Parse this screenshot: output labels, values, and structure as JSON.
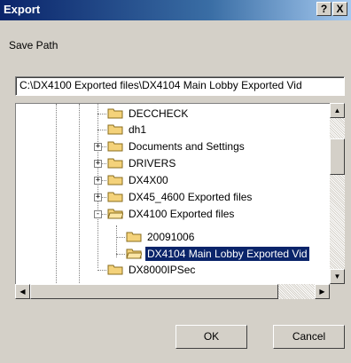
{
  "window": {
    "title": "Export",
    "help_glyph": "?",
    "close_glyph": "X"
  },
  "save_path": {
    "label": "Save Path",
    "value": "C:\\DX4100 Exported files\\DX4104 Main Lobby Exported Vid"
  },
  "tree": {
    "items": [
      {
        "label": "DECCHECK",
        "expander": ""
      },
      {
        "label": "dh1",
        "expander": ""
      },
      {
        "label": "Documents and Settings",
        "expander": "+"
      },
      {
        "label": "DRIVERS",
        "expander": "+"
      },
      {
        "label": "DX4X00",
        "expander": "+"
      },
      {
        "label": "DX45_4600 Exported files",
        "expander": "+"
      },
      {
        "label": "DX4100 Exported files",
        "expander": "-"
      },
      {
        "label": "20091006",
        "expander": ""
      },
      {
        "label": "DX4104 Main Lobby Exported Vid",
        "expander": "",
        "selected": true
      },
      {
        "label": "DX8000IPSec",
        "expander": ""
      }
    ]
  },
  "buttons": {
    "ok": "OK",
    "cancel": "Cancel"
  },
  "colors": {
    "title_bar": "#0a246a",
    "folder": "#f4d27a",
    "selection": "#0a246a"
  }
}
